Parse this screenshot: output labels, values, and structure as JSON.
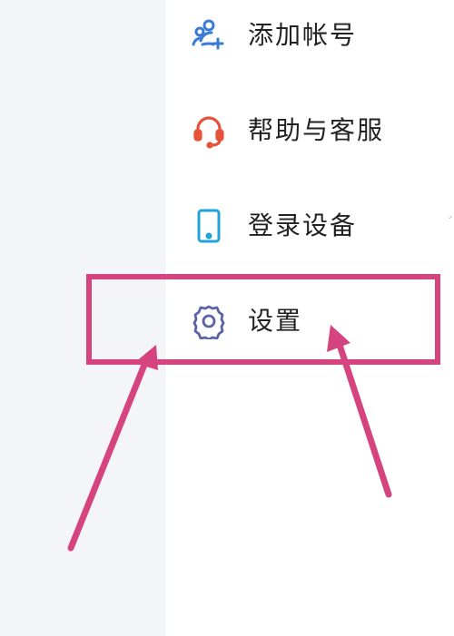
{
  "menu": {
    "items": [
      {
        "label": "添加帐号",
        "icon": "add-account-icon"
      },
      {
        "label": "帮助与客服",
        "icon": "headset-icon"
      },
      {
        "label": "登录设备",
        "icon": "phone-icon"
      },
      {
        "label": "设置",
        "icon": "gear-icon"
      }
    ]
  },
  "annotation": {
    "highlight_color": "#d6447f",
    "highlighted_item": "设置",
    "arrow_icons": [
      "arrow-icon",
      "arrow-icon"
    ]
  },
  "colors": {
    "add_account_icon": "#3a7bd5",
    "help_icon": "#e5533d",
    "device_icon": "#1fa3d9",
    "settings_icon": "#5a63a8",
    "left_panel_bg": "#f4f5f9",
    "text": "#222222"
  }
}
